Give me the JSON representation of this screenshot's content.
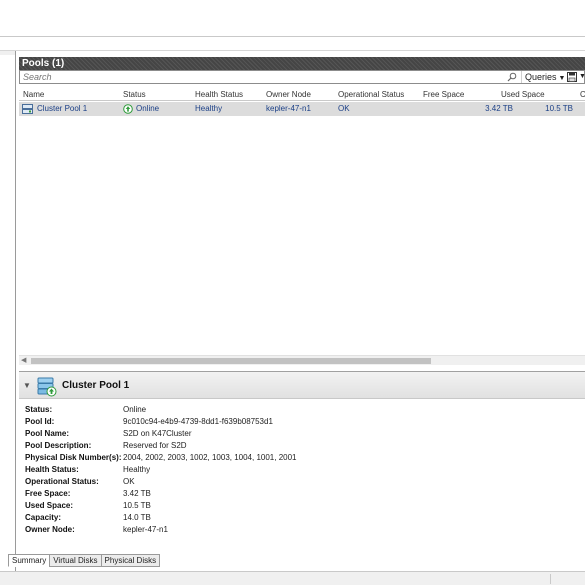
{
  "pools": {
    "header": "Pools (1)",
    "search_placeholder": "Search",
    "queries_label": "Queries",
    "columns": [
      "Name",
      "Status",
      "Health Status",
      "Owner Node",
      "Operational Status",
      "Free Space",
      "Used Space",
      "C"
    ],
    "rows": [
      {
        "name": "Cluster Pool 1",
        "status": "Online",
        "health": "Healthy",
        "owner": "kepler-47-n1",
        "operational": "OK",
        "free": "3.42 TB",
        "used": "10.5 TB"
      }
    ]
  },
  "detail": {
    "title": "Cluster Pool 1",
    "properties": [
      {
        "key": "Status:",
        "value": "Online"
      },
      {
        "key": "Pool Id:",
        "value": "9c010c94-e4b9-4739-8dd1-f639b08753d1"
      },
      {
        "key": "Pool Name:",
        "value": "S2D on K47Cluster"
      },
      {
        "key": "Pool Description:",
        "value": "Reserved for S2D"
      },
      {
        "key": "Physical Disk Number(s):",
        "value": "2004, 2002, 2003, 1002, 1003, 1004, 1001, 2001"
      },
      {
        "key": "Health Status:",
        "value": "Healthy"
      },
      {
        "key": "Operational Status:",
        "value": "OK"
      },
      {
        "key": "Free Space:",
        "value": "3.42 TB"
      },
      {
        "key": "Used Space:",
        "value": "10.5 TB"
      },
      {
        "key": "Capacity:",
        "value": "14.0 TB"
      },
      {
        "key": "Owner Node:",
        "value": "kepler-47-n1"
      }
    ],
    "tabs": [
      "Summary",
      "Virtual Disks",
      "Physical Disks"
    ]
  },
  "colors": {
    "header_bg": "#4d4d4d",
    "row_selected": "#dcdcdc",
    "link_text": "#1b3f86",
    "online_green": "#2e9b3a"
  },
  "icons": {
    "search": "search-icon",
    "save": "save-icon",
    "pool": "storage-pool-icon",
    "online": "online-status-icon",
    "collapse": "chevron-down-icon"
  }
}
